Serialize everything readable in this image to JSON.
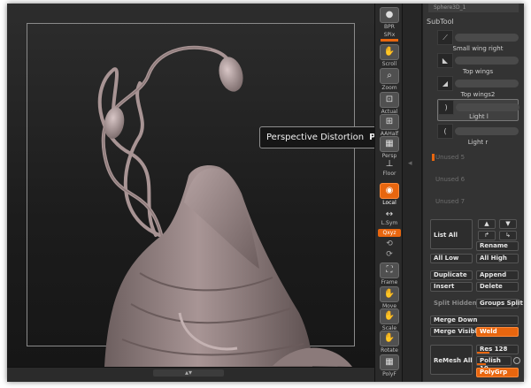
{
  "toolbar": {
    "buttons": [
      {
        "label": "BPR"
      },
      {
        "label": "SPix"
      },
      {
        "label": "Scroll"
      },
      {
        "label": "Zoom"
      },
      {
        "label": "Actual"
      },
      {
        "label": "AAHalf"
      },
      {
        "label": "Persp"
      },
      {
        "label": "Floor"
      },
      {
        "label": "Local"
      },
      {
        "label": "L.Sym"
      },
      {
        "label": "Qxyz"
      },
      {
        "label": "Frame"
      },
      {
        "label": "Move"
      },
      {
        "label": "Scale"
      },
      {
        "label": "Rotate"
      },
      {
        "label": "PolyF"
      }
    ]
  },
  "tooltip": {
    "text": "Perspective Distortion",
    "hotkey": "P"
  },
  "panel": {
    "top_field": "Sphere3D_1",
    "subtool_title": "SubTool",
    "subtools": [
      {
        "name": "Small wing right"
      },
      {
        "name": "Top wings"
      },
      {
        "name": "Top wings2"
      },
      {
        "name": "Light l"
      },
      {
        "name": "Light r"
      }
    ],
    "unused": [
      "Unused 5",
      "Unused 6",
      "Unused 7"
    ],
    "buttons": {
      "list_all": "List All",
      "rename": "Rename",
      "all_low": "All Low",
      "all_high": "All High",
      "duplicate": "Duplicate",
      "append": "Append",
      "insert": "Insert",
      "delete": "Delete",
      "split_hidden": "Split Hidden",
      "groups_split": "Groups Split",
      "merge_down": "Merge Down",
      "merge_visible": "Merge Visible",
      "weld": "Weld",
      "remesh_all": "ReMesh All",
      "polygrp": "PolyGrp"
    },
    "sliders": {
      "res_label": "Res",
      "res_value": "128",
      "polish_label": "Polish",
      "polish_value": "10"
    }
  },
  "colors": {
    "accent": "#e8660f",
    "model": "#a39090",
    "panel": "#333333"
  }
}
